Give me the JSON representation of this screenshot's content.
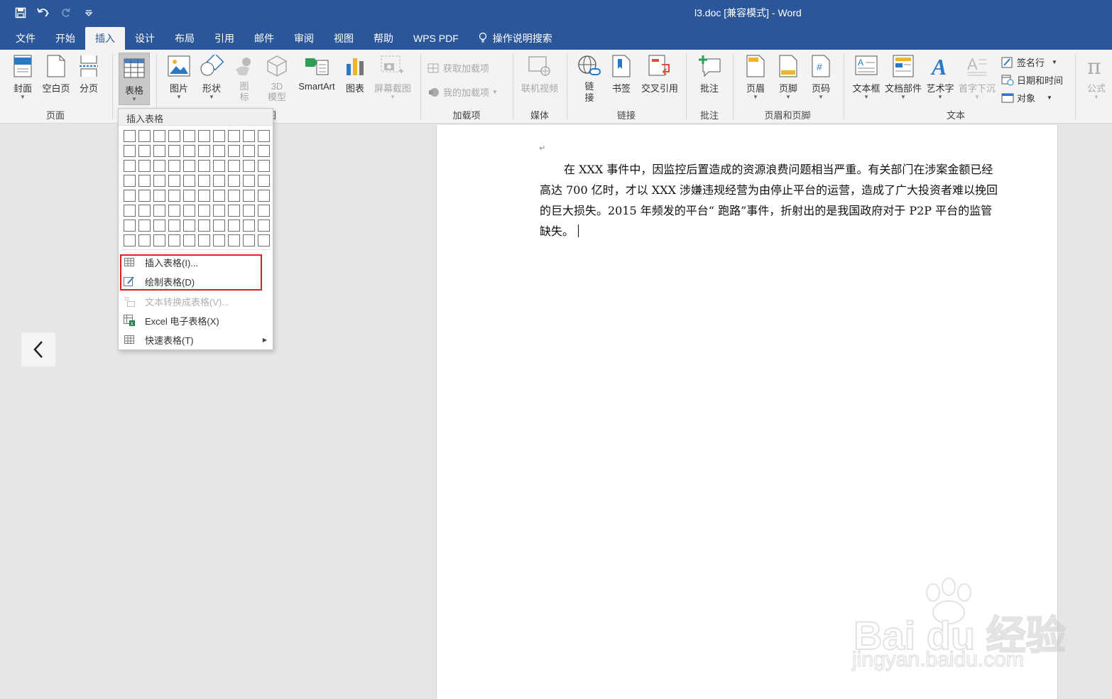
{
  "app": {
    "document_title": "l3.doc [兼容模式]  -  Word"
  },
  "qat": {
    "save_icon": "save-icon",
    "undo_icon": "undo-icon",
    "redo_icon": "redo-icon",
    "customize_icon": "customize-qat-icon"
  },
  "tabs": [
    {
      "label": "文件"
    },
    {
      "label": "开始"
    },
    {
      "label": "插入"
    },
    {
      "label": "设计"
    },
    {
      "label": "布局"
    },
    {
      "label": "引用"
    },
    {
      "label": "邮件"
    },
    {
      "label": "审阅"
    },
    {
      "label": "视图"
    },
    {
      "label": "帮助"
    },
    {
      "label": "WPS PDF"
    },
    {
      "label": "操作说明搜索"
    }
  ],
  "active_tab": "插入",
  "ribbon": {
    "pages": {
      "label": "页面",
      "cover": "封面",
      "blank": "空白页",
      "break": "分页"
    },
    "tables": {
      "table": "表格"
    },
    "illustrations": {
      "label": "插图",
      "picture": "图片",
      "shape": "形状",
      "icon_l1": "图",
      "icon_l2": "标",
      "model_l1": "3D",
      "model_l2": "模型",
      "smartart": "SmartArt",
      "chart": "图表",
      "screenshot": "屏幕截图"
    },
    "addins": {
      "label": "加载项",
      "get": "获取加载项",
      "mine": "我的加载项"
    },
    "media": {
      "label": "媒体",
      "video": "联机视频"
    },
    "links": {
      "label": "链接",
      "link_l1": "链",
      "link_l2": "接",
      "bookmark": "书签",
      "crossref": "交叉引用"
    },
    "comments": {
      "label": "批注",
      "comment": "批注"
    },
    "header_footer": {
      "label": "页眉和页脚",
      "header": "页眉",
      "footer": "页脚",
      "page_number": "页码"
    },
    "text": {
      "label": "文本",
      "textbox": "文本框",
      "parts": "文档部件",
      "wordart": "艺术字",
      "dropcap": "首字下沉",
      "signature": "签名行",
      "datetime": "日期和时间",
      "object": "对象"
    },
    "symbols": {
      "equation": "公式"
    }
  },
  "dropdown": {
    "header": "插入表格",
    "grid": {
      "rows": 8,
      "cols": 10
    },
    "items": [
      {
        "label": "插入表格(I)...",
        "disabled": false
      },
      {
        "label": "绘制表格(D)",
        "disabled": false
      },
      {
        "label": "文本转换成表格(V)...",
        "disabled": true
      },
      {
        "label": "Excel 电子表格(X)",
        "disabled": false
      },
      {
        "label": "快速表格(T)",
        "disabled": false,
        "submenu": true
      }
    ]
  },
  "document": {
    "paragraph": "在 XXX 事件中，因监控后置造成的资源浪费问题相当严重。有关部门在涉案金额已经高达 700 亿时，才以 XXX 涉嫌违规经营为由停止平台的运营，造成了广大投资者难以挽回的巨大损失。2015 年频发的平台“ 跑路”事件，折射出的是我国政府对于 P2P 平台的监管缺失。",
    "para_mark": "↵"
  },
  "watermark": {
    "brand": "Bai du 经验",
    "url": "jingyan.baidu.com"
  },
  "colors": {
    "title_bar": "#2b579a",
    "ribbon": "#f3f3f3",
    "highlight": "#e02020",
    "workspace": "#e6e6e6"
  }
}
